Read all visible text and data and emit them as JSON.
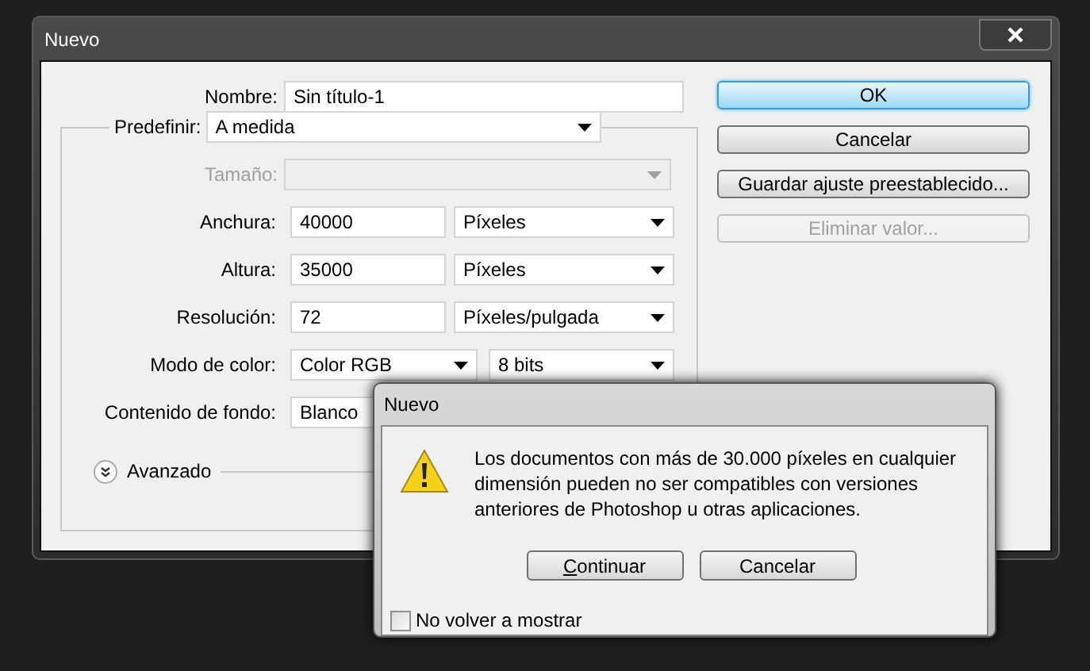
{
  "window": {
    "title": "Nuevo"
  },
  "form": {
    "name": {
      "label": "Nombre:",
      "value": "Sin título-1"
    },
    "preset": {
      "label": "Predefinir:",
      "value": "A medida"
    },
    "size": {
      "label": "Tamaño:",
      "disabled": true
    },
    "rows": [
      {
        "kind": "unit",
        "label": "Anchura:",
        "value": "40000",
        "unit": "Píxeles"
      },
      {
        "kind": "unit",
        "label": "Altura:",
        "value": "35000",
        "unit": "Píxeles"
      },
      {
        "kind": "unit",
        "label": "Resolución:",
        "value": "72",
        "unit": "Píxeles/pulgada"
      },
      {
        "kind": "double",
        "label": "Modo de color:",
        "value": "Color RGB",
        "unit": "8 bits"
      },
      {
        "kind": "single",
        "label": "Contenido de fondo:",
        "value": "Blanco"
      }
    ],
    "advanced": {
      "label": "Avanzado",
      "expanded": false
    }
  },
  "buttons": [
    {
      "label": "OK",
      "default": true,
      "disabled": false
    },
    {
      "label": "Cancelar",
      "default": false,
      "disabled": false
    },
    {
      "label": "Guardar ajuste preestablecido...",
      "default": false,
      "disabled": false
    },
    {
      "label": "Eliminar valor...",
      "default": false,
      "disabled": true
    }
  ],
  "alert": {
    "title": "Nuevo",
    "message": "Los documentos con más de 30.000 píxeles en cualquier dimensión pueden no ser compatibles con versiones anteriores de Photoshop u otras aplicaciones.",
    "buttons": [
      {
        "label": "Continuar",
        "mnemonic": true
      },
      {
        "label": "Cancelar",
        "mnemonic": false
      }
    ],
    "dont_show": {
      "label": "No volver a mostrar",
      "checked": false
    }
  }
}
